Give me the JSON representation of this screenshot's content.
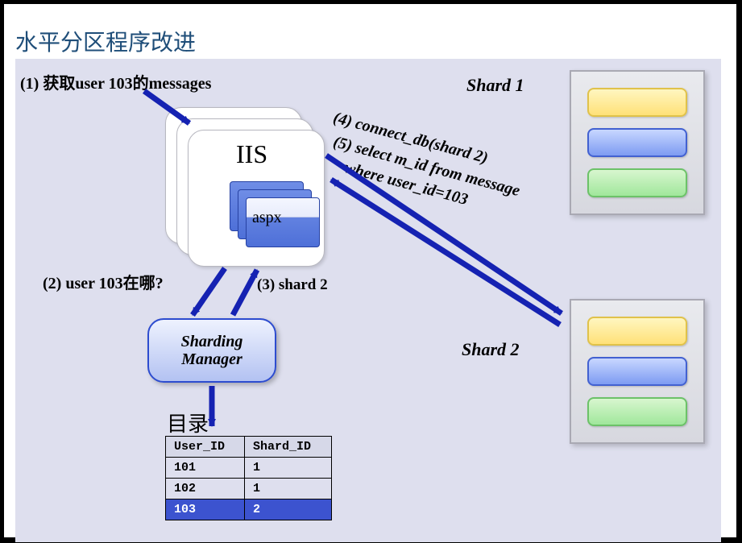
{
  "title": "水平分区程序改进",
  "steps": {
    "s1": "(1) 获取user 103的messages",
    "s2": "(2) user 103在哪?",
    "s3": "(3) shard 2",
    "s4": "(4) connect_db(shard 2)",
    "s5": "(5) select m_id from message",
    "s5b": "where user_id=103"
  },
  "iis_label": "IIS",
  "aspx_label": "aspx",
  "sharding_manager_line1": "Sharding",
  "sharding_manager_line2": "Manager",
  "directory_label": "目录",
  "dir_headers": {
    "uid": "User_ID",
    "sid": "Shard_ID"
  },
  "dir_rows": [
    {
      "uid": "101",
      "sid": "1",
      "highlight": false
    },
    {
      "uid": "102",
      "sid": "1",
      "highlight": false
    },
    {
      "uid": "103",
      "sid": "2",
      "highlight": true
    }
  ],
  "shard1_label": "Shard 1",
  "shard2_label": "Shard 2",
  "colors": {
    "accent_blue": "#1522B2",
    "title_blue": "#1F4E79",
    "bg_canvas": "#DEDFEE",
    "highlight_row": "#3c53cf"
  }
}
